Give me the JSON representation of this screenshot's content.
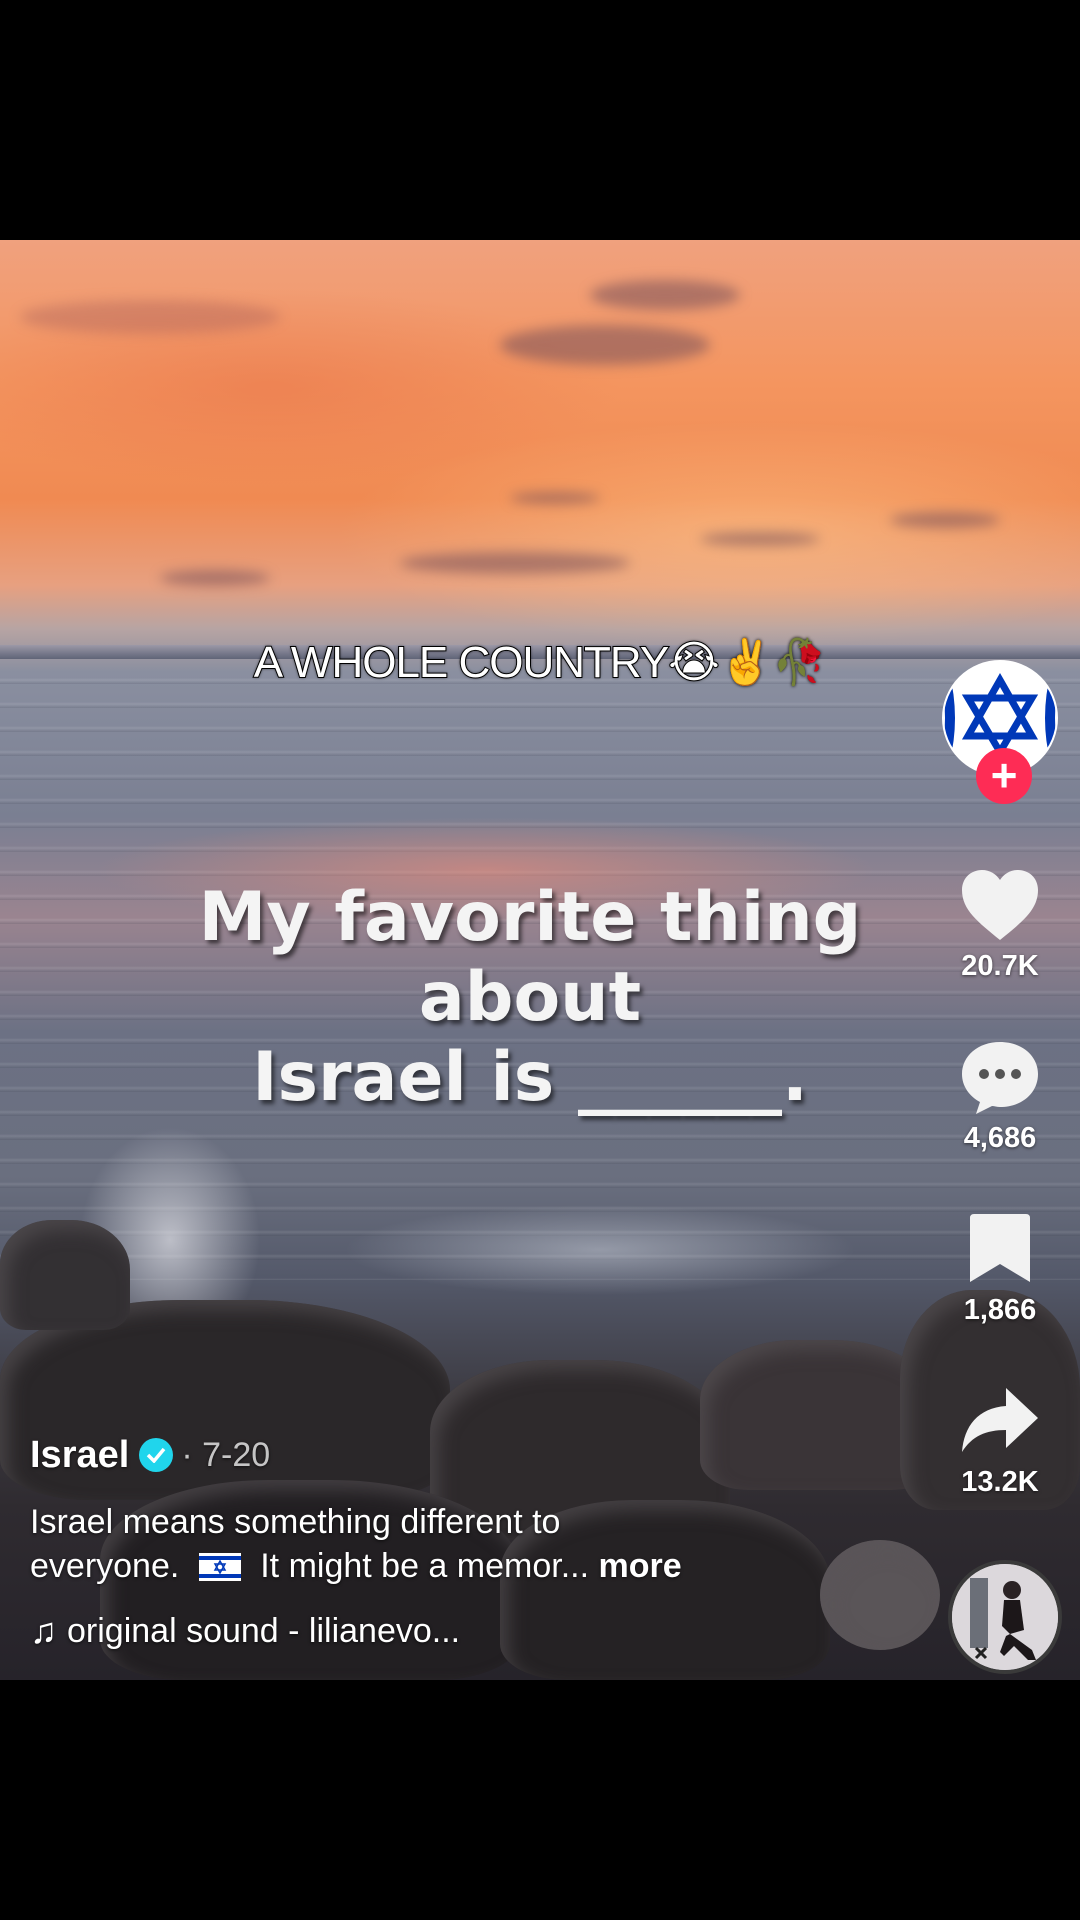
{
  "video": {
    "caption_top": "A WHOLE COUNTRY😭✌️🥀",
    "overlay_line1": "My favorite thing about",
    "overlay_line2": "Israel is ______."
  },
  "right_rail": {
    "avatar_icon": "star-of-david-icon",
    "follow_label": "+",
    "likes_count": "20.7K",
    "comments_count": "4,686",
    "saves_count": "1,866",
    "shares_count": "13.2K"
  },
  "post": {
    "author": "Israel",
    "date": "· 7-20",
    "description_line1": "Israel means something different to",
    "description_line2_a": "everyone.",
    "description_line2_b": "It might be a memor...",
    "more_label": "more",
    "sound": "original sound - lilianevo..."
  },
  "colors": {
    "follow_button": "#fe2c55",
    "verified_badge": "#20d5ec",
    "flag_blue": "#0038b8"
  }
}
